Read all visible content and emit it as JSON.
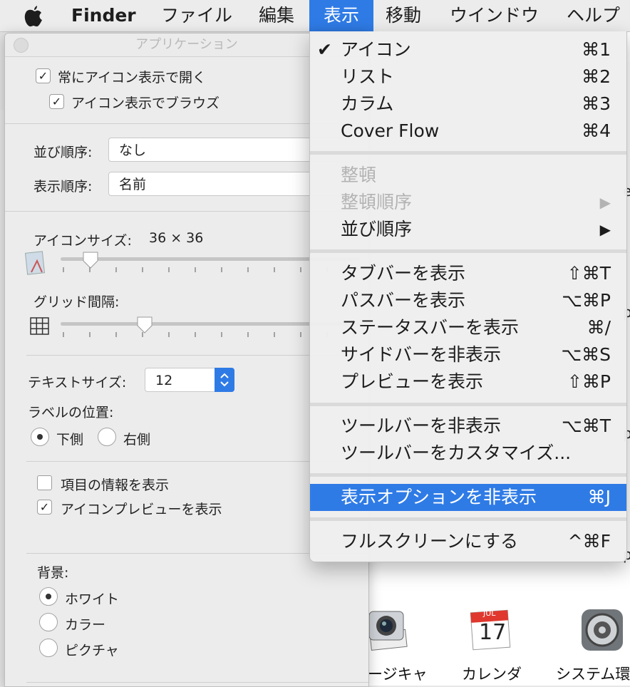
{
  "menubar": {
    "app": "Finder",
    "items": [
      "ファイル",
      "編集",
      "表示",
      "移動",
      "ウインドウ",
      "ヘルプ"
    ],
    "active": "表示"
  },
  "view_menu": {
    "items": [
      {
        "label": "アイコン",
        "shortcut": "⌘1",
        "checked": true
      },
      {
        "label": "リスト",
        "shortcut": "⌘2"
      },
      {
        "label": "カラム",
        "shortcut": "⌘3"
      },
      {
        "label": "Cover Flow",
        "shortcut": "⌘4"
      },
      {
        "label": "整頓",
        "disabled": true
      },
      {
        "label": "整頓順序",
        "disabled": true,
        "submenu": true
      },
      {
        "label": "並び順序",
        "submenu": true
      },
      {
        "label": "タブバーを表示",
        "shortcut": "⇧⌘T"
      },
      {
        "label": "パスバーを表示",
        "shortcut": "⌥⌘P"
      },
      {
        "label": "ステータスバーを表示",
        "shortcut": "⌘/"
      },
      {
        "label": "サイドバーを非表示",
        "shortcut": "⌥⌘S"
      },
      {
        "label": "プレビューを表示",
        "shortcut": "⇧⌘P"
      },
      {
        "label": "ツールバーを非表示",
        "shortcut": "⌥⌘T"
      },
      {
        "label": "ツールバーをカスタマイズ..."
      },
      {
        "label": "表示オプションを非表示",
        "shortcut": "⌘J",
        "highlighted": true
      },
      {
        "label": "フルスクリーンにする",
        "shortcut": "^⌘F"
      }
    ]
  },
  "options_panel": {
    "title": "アプリケーション",
    "always_open_icon": {
      "label": "常にアイコン表示で開く",
      "checked": true
    },
    "browse_icon": {
      "label": "アイコン表示でブラウズ",
      "checked": true
    },
    "sort_label": "並び順序:",
    "sort_value": "なし",
    "arrange_label": "表示順序:",
    "arrange_value": "名前",
    "icon_size_label": "アイコンサイズ:",
    "icon_size_value": "36 × 36",
    "icon_size_slider": 0.1,
    "grid_label": "グリッド間隔:",
    "grid_slider": 0.28,
    "text_size_label": "テキストサイズ:",
    "text_size_value": "12",
    "label_pos_label": "ラベルの位置:",
    "label_bottom": "下側",
    "label_right": "右側",
    "label_pos_selected": "下側",
    "show_item_info": {
      "label": "項目の情報を表示",
      "checked": false
    },
    "show_icon_preview": {
      "label": "アイコンプレビューを表示",
      "checked": true
    },
    "background_label": "背景:",
    "bg_white": "ホワイト",
    "bg_color": "カラー",
    "bg_picture": "ピクチャ",
    "bg_selected": "ホワイト"
  },
  "background_apps": [
    {
      "label": "ージキャ",
      "icon": "image-capture-icon"
    },
    {
      "label": "カレンダ",
      "icon": "calendar-icon",
      "month": "JUL",
      "day": "17"
    },
    {
      "label": "システム環",
      "icon": "system-preferences-icon"
    }
  ],
  "background_fragments": [
    "e",
    "p",
    "p"
  ],
  "colors": {
    "accent": "#2f7be6",
    "menubar": "#ececec",
    "panel": "#ececec"
  }
}
